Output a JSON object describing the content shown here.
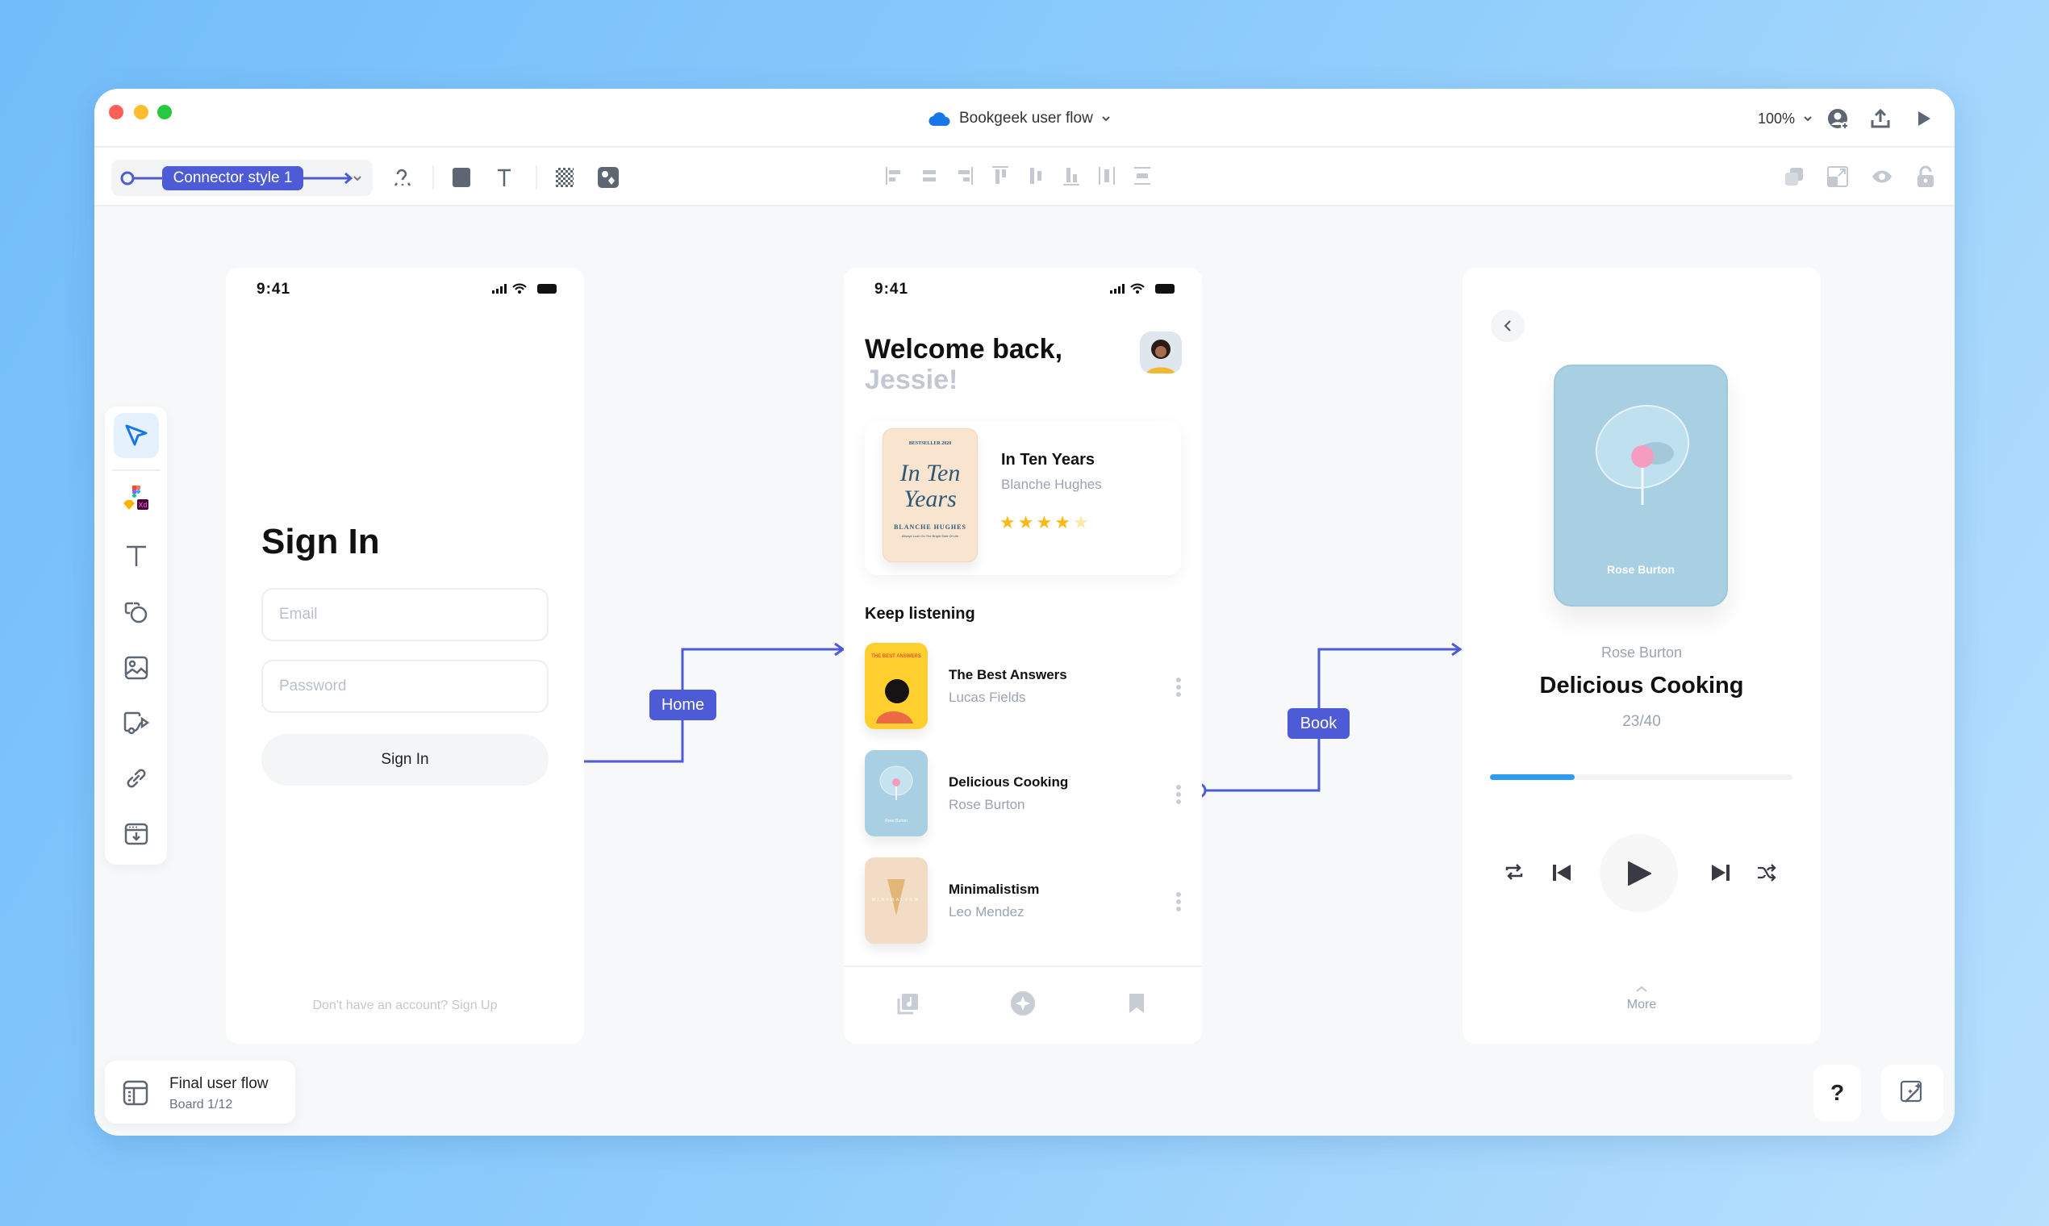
{
  "window": {
    "title": "Bookgeek user flow",
    "zoom": "100%"
  },
  "toolbar": {
    "connector_style": "Connector style 1"
  },
  "colors": {
    "accent": "#4d5bd6",
    "progress": "#2d9bf0",
    "star": "#fdb913"
  },
  "connectors": [
    {
      "label": "Home"
    },
    {
      "label": "Book"
    }
  ],
  "board": {
    "name": "Final user flow",
    "count": "Board 1/12"
  },
  "help": "?",
  "signin": {
    "time": "9:41",
    "heading": "Sign In",
    "email_placeholder": "Email",
    "password_placeholder": "Password",
    "button": "Sign In",
    "footer": "Don't have an account? Sign Up"
  },
  "home": {
    "time": "9:41",
    "greeting": "Welcome back,",
    "name": "Jessie!",
    "featured": {
      "title": "In Ten Years",
      "author": "Blanche Hughes",
      "rating": 4,
      "max_rating": 5,
      "cover_top": "BESTSELLER 2020",
      "cover_title": "In Ten Years",
      "cover_author": "BLANCHE HUGHES",
      "cover_tagline": "Always Look On The Bright Side Of Life"
    },
    "section": "Keep listening",
    "items": [
      {
        "title": "The Best Answers",
        "author": "Lucas Fields",
        "cover_text": "THE BEST ANSWERS"
      },
      {
        "title": "Delicious Cooking",
        "author": "Rose Burton",
        "cover_text": "Rose Burton"
      },
      {
        "title": "Minimalistism",
        "author": "Leo Mendez",
        "cover_text": "MINIMALISM"
      }
    ]
  },
  "player": {
    "cover_author": "Rose Burton",
    "author": "Rose Burton",
    "title": "Delicious Cooking",
    "chapter": "23/40",
    "progress": 0.28,
    "more": "More"
  }
}
